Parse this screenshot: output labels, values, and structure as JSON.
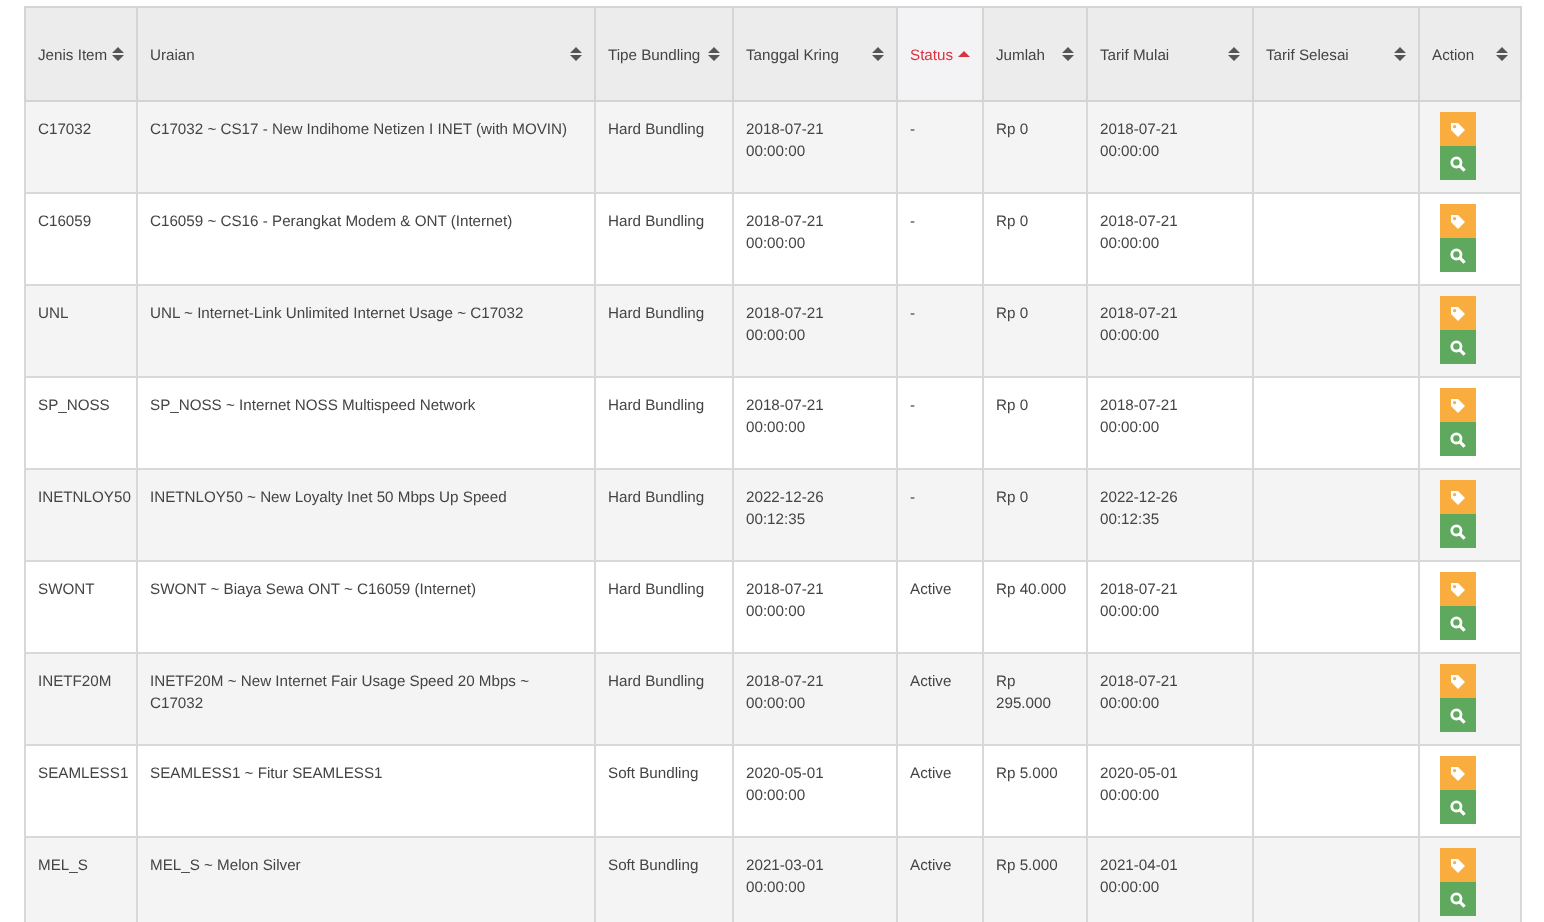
{
  "table": {
    "columns": [
      {
        "label": "Jenis Item",
        "sorted": false
      },
      {
        "label": "Uraian",
        "sorted": false
      },
      {
        "label": "Tipe Bundling",
        "sorted": false
      },
      {
        "label": "Tanggal Kring",
        "sorted": false
      },
      {
        "label": "Status",
        "sorted": true
      },
      {
        "label": "Jumlah",
        "sorted": false
      },
      {
        "label": "Tarif Mulai",
        "sorted": false
      },
      {
        "label": "Tarif Selesai",
        "sorted": false
      },
      {
        "label": "Action",
        "sorted": false
      }
    ],
    "rows": [
      {
        "item": "C17032",
        "uraian": "C17032 ~ CS17 - New Indihome Netizen I INET (with MOVIN)",
        "tipe": "Hard Bundling",
        "tanggal": "2018-07-21 00:00:00",
        "status": "-",
        "jumlah": "Rp 0",
        "tarif_mulai": "2018-07-21 00:00:00"
      },
      {
        "item": "C16059",
        "uraian": "C16059 ~ CS16 - Perangkat Modem & ONT (Internet)",
        "tipe": "Hard Bundling",
        "tanggal": "2018-07-21 00:00:00",
        "status": "-",
        "jumlah": "Rp 0",
        "tarif_mulai": "2018-07-21 00:00:00"
      },
      {
        "item": "UNL",
        "uraian": "UNL ~ Internet-Link Unlimited Internet Usage ~ C17032",
        "tipe": "Hard Bundling",
        "tanggal": "2018-07-21 00:00:00",
        "status": "-",
        "jumlah": "Rp 0",
        "tarif_mulai": "2018-07-21 00:00:00"
      },
      {
        "item": "SP_NOSS",
        "uraian": "SP_NOSS ~ Internet NOSS Multispeed Network",
        "tipe": "Hard Bundling",
        "tanggal": "2018-07-21 00:00:00",
        "status": "-",
        "jumlah": "Rp 0",
        "tarif_mulai": "2018-07-21 00:00:00"
      },
      {
        "item": "INETNLOY50",
        "uraian": "INETNLOY50 ~ New Loyalty Inet 50 Mbps Up Speed",
        "tipe": "Hard Bundling",
        "tanggal": "2022-12-26 00:12:35",
        "status": "-",
        "jumlah": "Rp 0",
        "tarif_mulai": "2022-12-26 00:12:35"
      },
      {
        "item": "SWONT",
        "uraian": "SWONT ~ Biaya Sewa ONT ~ C16059 (Internet)",
        "tipe": "Hard Bundling",
        "tanggal": "2018-07-21 00:00:00",
        "status": "Active",
        "jumlah": "Rp 40.000",
        "tarif_mulai": "2018-07-21 00:00:00"
      },
      {
        "item": "INETF20M",
        "uraian": "INETF20M ~ New Internet Fair Usage Speed 20 Mbps ~ C17032",
        "tipe": "Hard Bundling",
        "tanggal": "2018-07-21 00:00:00",
        "status": "Active",
        "jumlah": "Rp 295.000",
        "tarif_mulai": "2018-07-21 00:00:00"
      },
      {
        "item": "SEAMLESS1",
        "uraian": "SEAMLESS1 ~ Fitur SEAMLESS1",
        "tipe": "Soft Bundling",
        "tanggal": "2020-05-01 00:00:00",
        "status": "Active",
        "jumlah": "Rp 5.000",
        "tarif_mulai": "2020-05-01 00:00:00"
      },
      {
        "item": "MEL_S",
        "uraian": "MEL_S ~ Melon Silver",
        "tipe": "Soft Bundling",
        "tanggal": "2021-03-01 00:00:00",
        "status": "Active",
        "jumlah": "Rp 5.000",
        "tarif_mulai": "2021-04-01 00:00:00"
      }
    ]
  }
}
